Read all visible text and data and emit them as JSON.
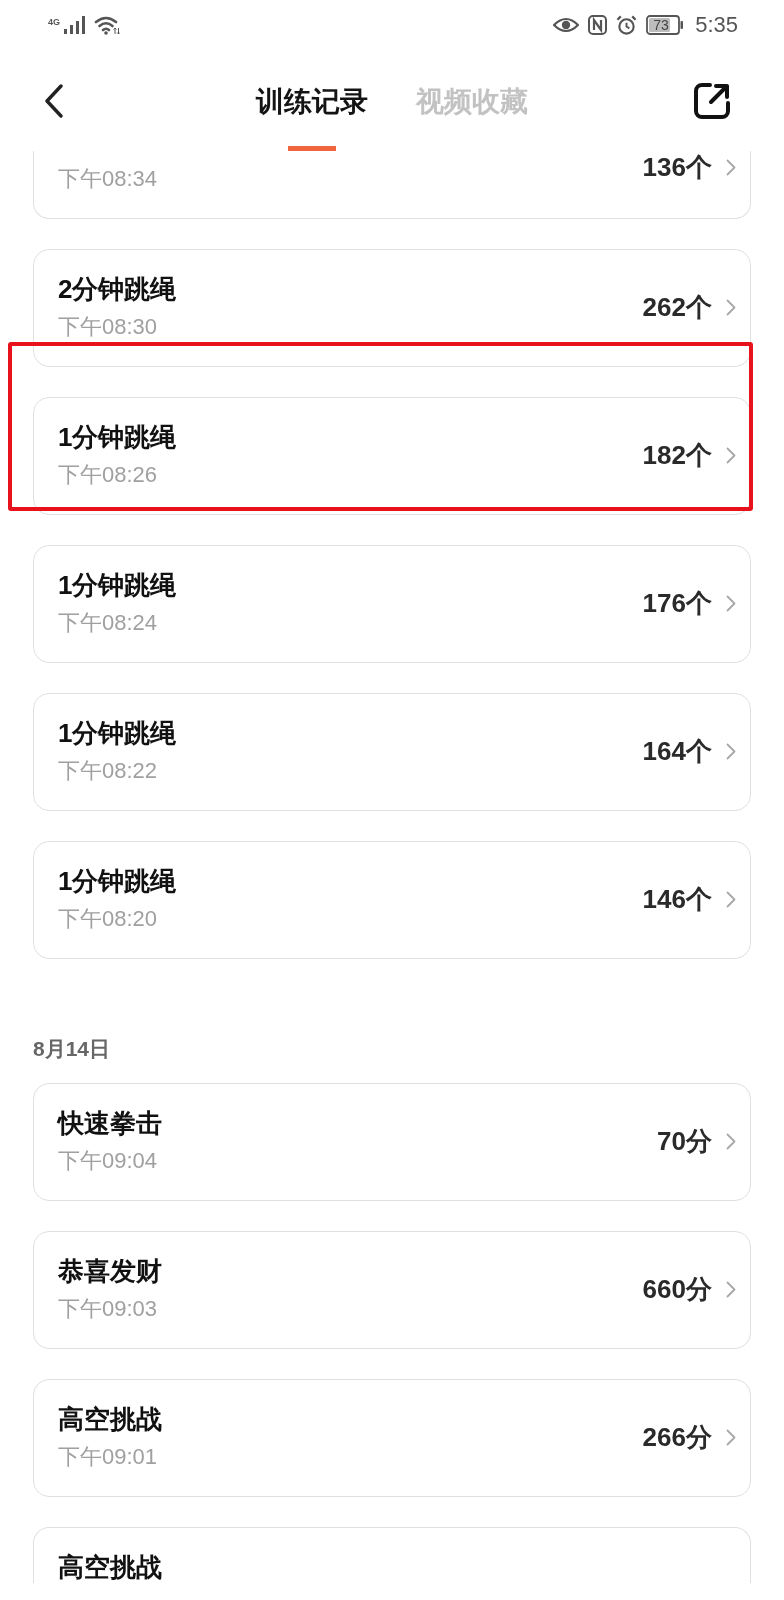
{
  "status_bar": {
    "network_type": "4G",
    "battery": "73",
    "time": "5:35"
  },
  "header": {
    "tabs": [
      {
        "label": "训练记录",
        "selected": true
      },
      {
        "label": "视频收藏",
        "selected": false
      }
    ]
  },
  "sections": [
    {
      "items": [
        {
          "time": "下午08:34",
          "value": "136个",
          "highlighted": false
        },
        {
          "title": "2分钟跳绳",
          "time": "下午08:30",
          "value": "262个",
          "highlighted": false
        },
        {
          "title": "1分钟跳绳",
          "time": "下午08:26",
          "value": "182个",
          "highlighted": true
        },
        {
          "title": "1分钟跳绳",
          "time": "下午08:24",
          "value": "176个",
          "highlighted": false
        },
        {
          "title": "1分钟跳绳",
          "time": "下午08:22",
          "value": "164个",
          "highlighted": false
        },
        {
          "title": "1分钟跳绳",
          "time": "下午08:20",
          "value": "146个",
          "highlighted": false
        }
      ]
    },
    {
      "date": "8月14日",
      "items": [
        {
          "title": "快速拳击",
          "time": "下午09:04",
          "value": "70分",
          "highlighted": false
        },
        {
          "title": "恭喜发财",
          "time": "下午09:03",
          "value": "660分",
          "highlighted": false
        },
        {
          "title": "高空挑战",
          "time": "下午09:01",
          "value": "266分",
          "highlighted": false
        },
        {
          "title": "高空挑战",
          "highlighted": false
        }
      ]
    }
  ]
}
